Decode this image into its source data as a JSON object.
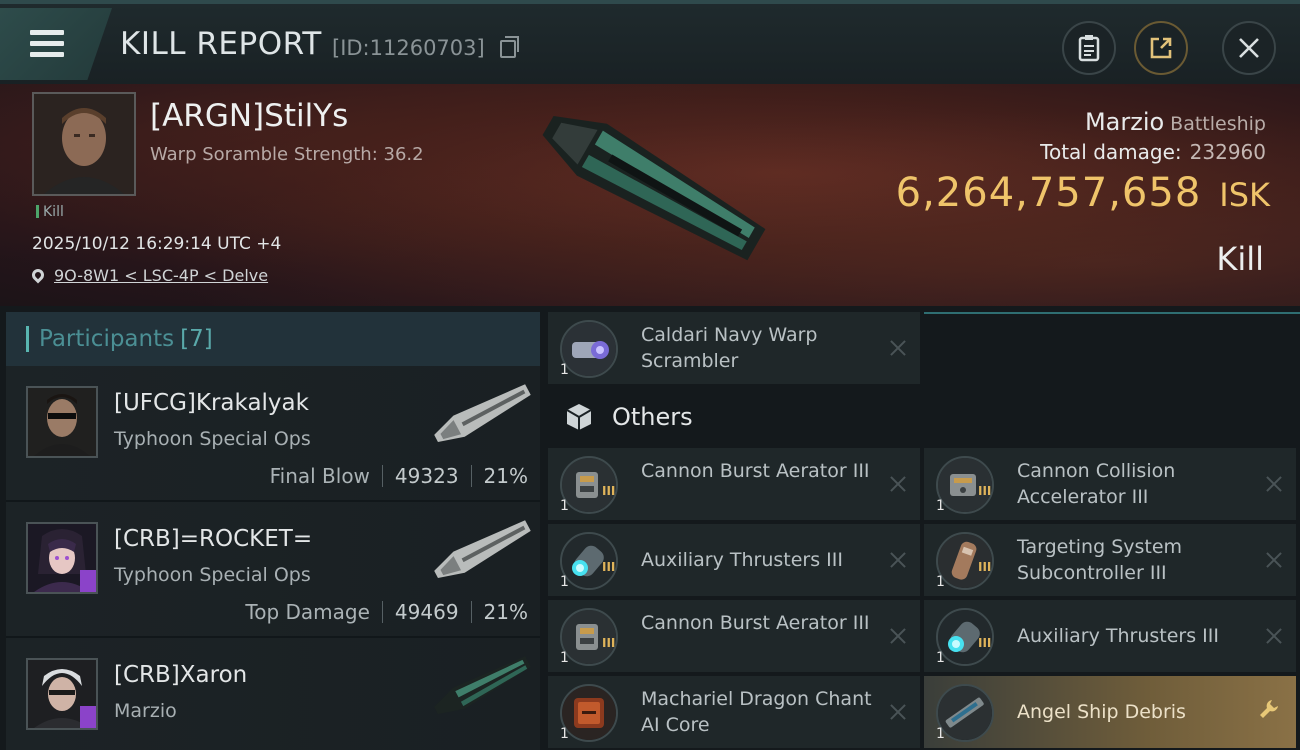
{
  "header": {
    "title": "KILL REPORT",
    "report_id": "[ID:11260703]"
  },
  "victim": {
    "name": "[ARGN]StilYs",
    "scramble_strength": "Warp Soramble Strength: 36.2",
    "kill_tag": "Kill",
    "timestamp": "2025/10/12 16:29:14 UTC +4",
    "location": "9O-8W1 < LSC-4P < Delve",
    "ship": "Marzio",
    "ship_class": "Battleship",
    "total_damage_label": "Total damage:",
    "total_damage": "232960",
    "isk_value": "6,264,757,658",
    "isk_unit": "ISK",
    "result": "Kill"
  },
  "participants": {
    "title": "Participants",
    "count": "[7]",
    "rows": [
      {
        "name": "[UFCG]Krakalyak",
        "ship": "Typhoon Special Ops",
        "label": "Final Blow",
        "damage": "49323",
        "percent": "21%"
      },
      {
        "name": "[CRB]=ROCKET=",
        "ship": "Typhoon Special Ops",
        "label": "Top Damage",
        "damage": "49469",
        "percent": "21%"
      },
      {
        "name": "[CRB]Xaron",
        "ship": "Marzio",
        "label": "",
        "damage": "",
        "percent": ""
      }
    ]
  },
  "items": {
    "top_item": {
      "name": "Caldari Navy Warp Scrambler",
      "qty": "1"
    },
    "others_title": "Others",
    "others": [
      {
        "name": "Cannon Burst Aerator III",
        "qty": "1"
      },
      {
        "name": "Cannon Collision Accelerator III",
        "qty": "1"
      },
      {
        "name": "Auxiliary Thrusters III",
        "qty": "1"
      },
      {
        "name": "Targeting System Subcontroller III",
        "qty": "1"
      },
      {
        "name": "Cannon Burst Aerator III",
        "qty": "1"
      },
      {
        "name": "Auxiliary Thrusters III",
        "qty": "1"
      },
      {
        "name": "Machariel Dragon Chant AI Core",
        "qty": "1"
      },
      {
        "name": "Angel Ship Debris",
        "qty": "1"
      }
    ],
    "tier_mark": "III"
  },
  "colors": {
    "isk": "#efc46a",
    "accent_teal": "#59b6b1",
    "highlight_gold": "#8a7146"
  },
  "icons": [
    "menu-icon",
    "copy-icon",
    "clipboard-icon",
    "share-icon",
    "close-icon",
    "location-pin-icon",
    "cube-icon",
    "wrench-icon",
    "remove-icon"
  ]
}
